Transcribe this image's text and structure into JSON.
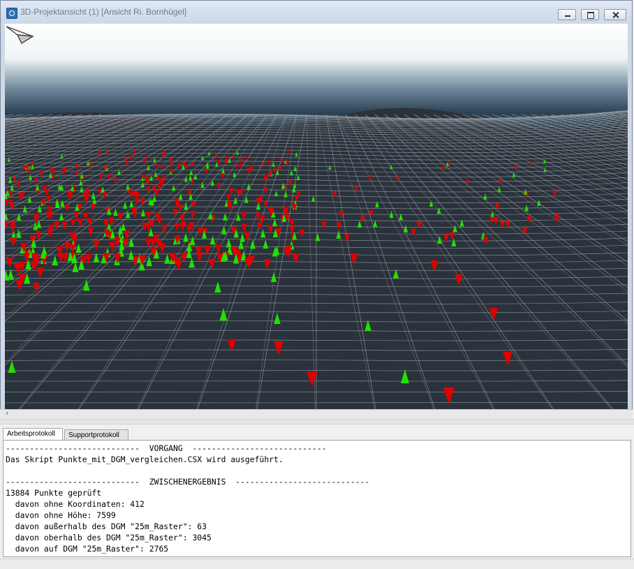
{
  "window": {
    "title": "3D-Projektansicht (1) [Ansicht Ri. Bornhügel]",
    "icon": "app-globe-icon"
  },
  "viewport": {
    "nav_icon": "paper-plane-navigation-icon",
    "marker_colors": {
      "above": "#e00000",
      "below": "#22e000"
    },
    "mesh_color": "#b8bcc2"
  },
  "scrollbar": {
    "left_arrow": "‹"
  },
  "tabs": [
    {
      "label": "Arbeitsprotokoll",
      "active": true
    },
    {
      "label": "Supportprotokoll",
      "active": false
    }
  ],
  "log": {
    "lines": [
      "----------------------------  VORGANG  ----------------------------",
      "Das Skript Punkte_mit_DGM_vergleichen.CSX wird ausgeführt.",
      "",
      "----------------------------  ZWISCHENERGEBNIS  ----------------------------",
      "13884 Punkte geprüft",
      "  davon ohne Koordinaten: 412",
      "  davon ohne Höhe: 7599",
      "  davon außerhalb des DGM \"25m_Raster\": 63",
      "  davon oberhalb des DGM \"25m_Raster\": 3045",
      "  davon auf DGM \"25m_Raster\": 2765"
    ]
  }
}
